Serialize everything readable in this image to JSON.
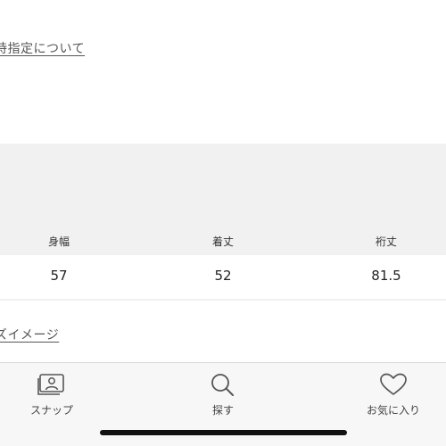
{
  "links": {
    "top_label": "時指定について",
    "mid_label": "ズイメージ"
  },
  "size_table": {
    "headers": [
      "身幅",
      "着丈",
      "裄丈"
    ],
    "values": [
      "57",
      "52",
      "81.5"
    ]
  },
  "tabbar": {
    "snap": {
      "label": "スナップ",
      "icon": "snap-photo-icon"
    },
    "search": {
      "label": "探す",
      "icon": "search-icon"
    },
    "favorites": {
      "label": "お気に入り",
      "icon": "heart-icon"
    }
  },
  "colors": {
    "panel_bg": "#f1f1f1",
    "tabbar_bg": "#f7f7f7",
    "text": "#333333"
  }
}
